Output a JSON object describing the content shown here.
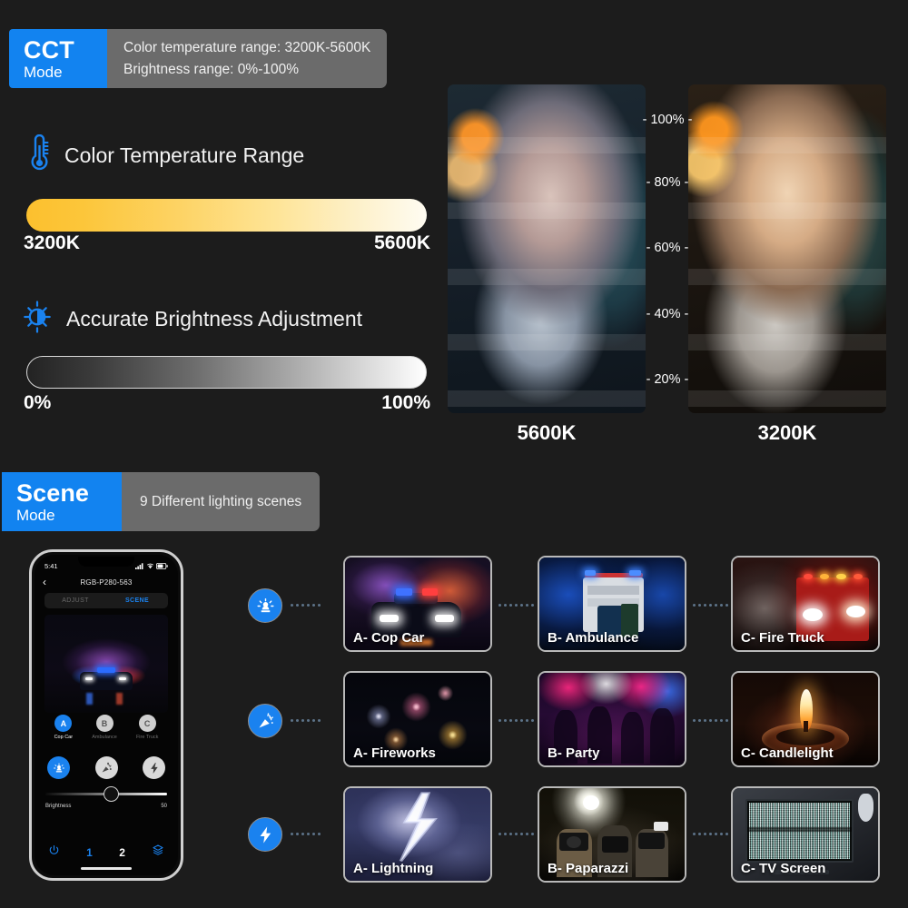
{
  "cct_section": {
    "badge": {
      "main": "CCT",
      "sub": "Mode"
    },
    "desc_line1": "Color temperature range: 3200K-5600K",
    "desc_line2": "Brightness range: 0%-100%",
    "features": [
      {
        "icon": "thermometer-icon",
        "title": "Color Temperature Range",
        "min_label": "3200K",
        "max_label": "5600K"
      },
      {
        "icon": "brightness-icon",
        "title": "Accurate Brightness Adjustment",
        "min_label": "0%",
        "max_label": "100%"
      }
    ],
    "comparison": {
      "scale_ticks": [
        "- 100% -",
        "- 80% -",
        "- 60% -",
        "- 40% -",
        "- 20% -"
      ],
      "left_photo_label": "5600K",
      "right_photo_label": "3200K"
    }
  },
  "scene_section": {
    "badge": {
      "main": "Scene",
      "sub": "Mode"
    },
    "desc": "9 Different lighting scenes",
    "phone": {
      "status_time": "5:41",
      "title": "RGB-P280-563",
      "back_icon": "chevron-left-icon",
      "tab_adjust": "ADJUST",
      "tab_scene": "SCENE",
      "presets": [
        {
          "letter": "A",
          "label": "Cop Car",
          "selected": true
        },
        {
          "letter": "B",
          "label": "Ambulance",
          "selected": false
        },
        {
          "letter": "C",
          "label": "Fire Truck",
          "selected": false
        }
      ],
      "mode_icons": [
        "siren-icon",
        "party-popper-icon",
        "lightning-bolt-icon"
      ],
      "brightness_label": "Brightness",
      "brightness_value": "50",
      "bottom_nav": [
        "power-icon",
        "1",
        "2",
        "layers-icon"
      ]
    },
    "rows": [
      {
        "row_icon": "siren-icon",
        "cards": [
          {
            "label": "A- Cop Car",
            "art": "cop-car"
          },
          {
            "label": "B- Ambulance",
            "art": "ambulance"
          },
          {
            "label": "C- Fire Truck",
            "art": "fire-truck"
          }
        ]
      },
      {
        "row_icon": "party-popper-icon",
        "cards": [
          {
            "label": "A- Fireworks",
            "art": "fireworks"
          },
          {
            "label": "B- Party",
            "art": "party"
          },
          {
            "label": "C- Candlelight",
            "art": "candlelight"
          }
        ]
      },
      {
        "row_icon": "lightning-bolt-icon",
        "cards": [
          {
            "label": "A- Lightning",
            "art": "lightning"
          },
          {
            "label": "B- Paparazzi",
            "art": "paparazzi"
          },
          {
            "label": "C- TV Screen",
            "art": "tv-screen"
          }
        ]
      }
    ]
  },
  "colors": {
    "accent_blue": "#1283f0",
    "background": "#1c1c1c",
    "desc_gray": "#6b6b6b",
    "warm_3200k": "#fcc02e",
    "cool_5600k": "#fffcf2"
  }
}
